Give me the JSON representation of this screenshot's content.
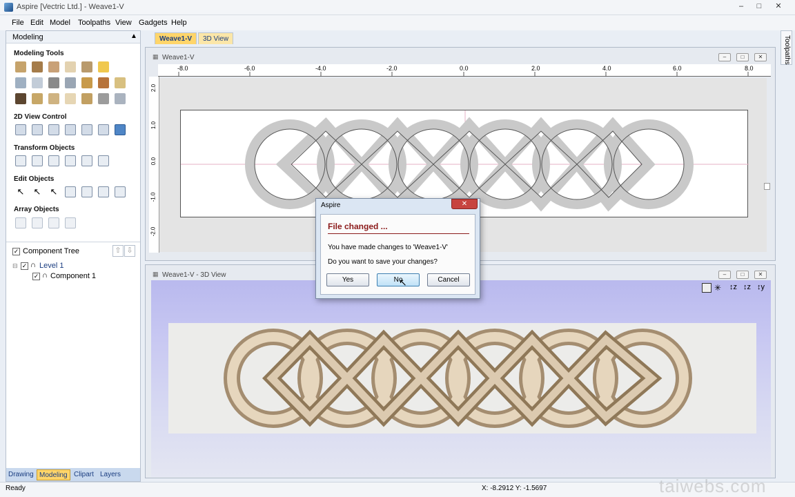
{
  "app": {
    "title": "Aspire [Vectric Ltd.] - Weave1-V"
  },
  "menu": [
    "File",
    "Edit",
    "Model",
    "Toolpaths",
    "View",
    "Gadgets",
    "Help"
  ],
  "left_panel": {
    "header": "Modeling",
    "sections": {
      "modeling_tools": "Modeling Tools",
      "view_control": "2D View Control",
      "transform": "Transform Objects",
      "edit": "Edit Objects",
      "array": "Array Objects"
    },
    "component_tree": {
      "title": "Component Tree",
      "level": "Level 1",
      "component": "Component 1"
    },
    "tabs": [
      "Drawing",
      "Modeling",
      "Clipart",
      "Layers"
    ],
    "active_tab": "Modeling"
  },
  "doc_tabs": [
    "Weave1-V",
    "3D View"
  ],
  "active_doc_tab": "Weave1-V",
  "toolpaths_tab": "Toolpaths",
  "view2d": {
    "title": "Weave1-V",
    "ruler_h": [
      "-8.0",
      "-6.0",
      "-4.0",
      "-2.0",
      "0.0",
      "2.0",
      "4.0",
      "6.0",
      "8.0"
    ],
    "ruler_v": [
      "2.0",
      "1.0",
      "0.0",
      "-1.0",
      "-2.0"
    ]
  },
  "view3d": {
    "title": "Weave1-V - 3D View"
  },
  "dialog": {
    "caption": "Aspire",
    "heading": "File changed ...",
    "line1": "You have made changes to 'Weave1-V'",
    "line2": "Do you want to save your changes?",
    "yes": "Yes",
    "no": "No",
    "cancel": "Cancel"
  },
  "status": {
    "left": "Ready",
    "coords": "X: -8.2912 Y: -1.5697"
  },
  "watermark": "taiwebs.com",
  "colors": {
    "heading_red": "#8b1a1a",
    "accent_tab": "#ffd56a",
    "link_blue": "#1a3d80"
  }
}
